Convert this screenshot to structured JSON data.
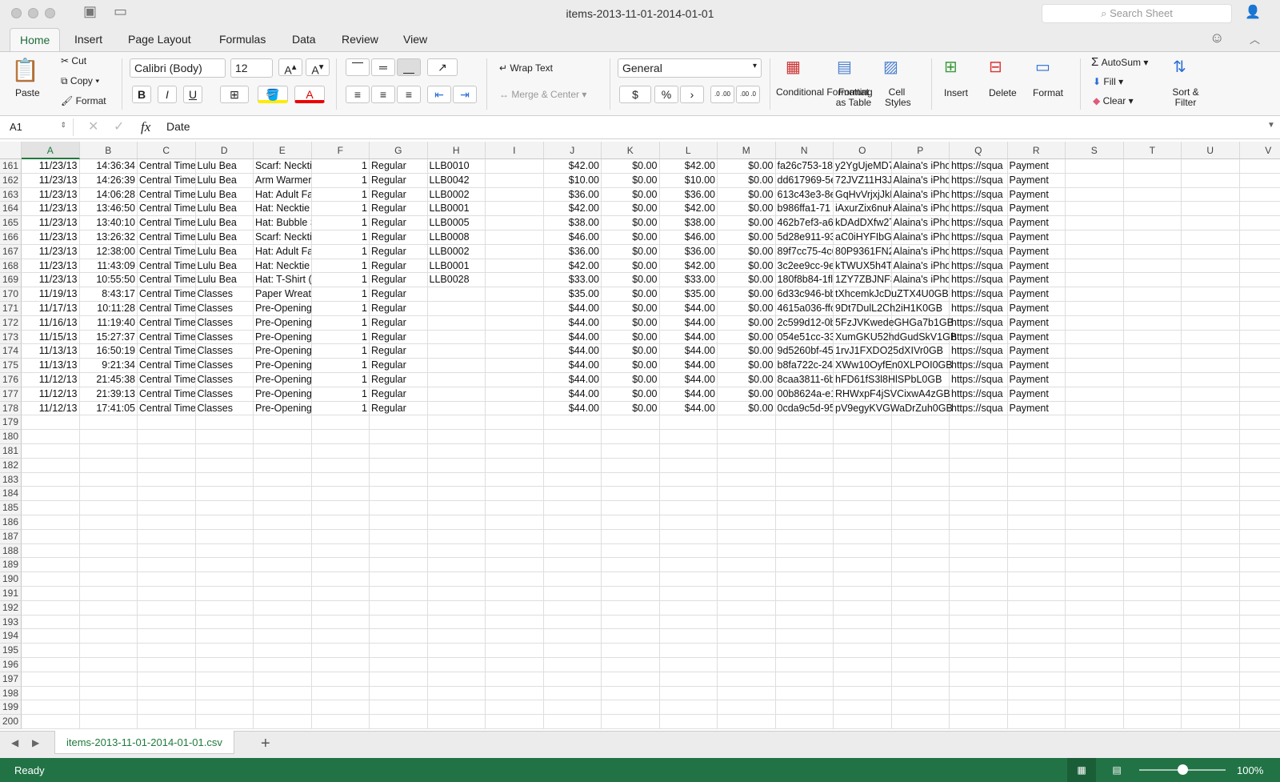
{
  "window": {
    "title": "items-2013-11-01-2014-01-01",
    "search_placeholder": "Search Sheet"
  },
  "tabs": [
    "Home",
    "Insert",
    "Page Layout",
    "Formulas",
    "Data",
    "Review",
    "View"
  ],
  "ribbon": {
    "paste": "Paste",
    "cut": "Cut",
    "copy": "Copy",
    "format_painter": "Format",
    "font": "Calibri (Body)",
    "size": "12",
    "bold": "B",
    "italic": "I",
    "underline": "U",
    "wrap": "Wrap Text",
    "merge": "Merge & Center",
    "number_format": "General",
    "currency": "$",
    "percent": "%",
    "comma": "›",
    "inc_dec": ".0 .00",
    "dec_dec": ".00 .0",
    "cond_fmt": "Conditional Formatting",
    "fmt_table": "Format as Table",
    "cell_styles": "Cell Styles",
    "insert": "Insert",
    "delete": "Delete",
    "format": "Format",
    "autosum": "AutoSum",
    "fill": "Fill",
    "clear": "Clear",
    "sort": "Sort & Filter"
  },
  "formula_bar": {
    "name_box": "A1",
    "fx": "fx",
    "value": "Date"
  },
  "columns": [
    "A",
    "B",
    "C",
    "D",
    "E",
    "F",
    "G",
    "H",
    "I",
    "J",
    "K",
    "L",
    "M",
    "N",
    "O",
    "P",
    "Q",
    "R",
    "S",
    "T",
    "U",
    "V"
  ],
  "rows": [
    {
      "n": "161",
      "c": [
        "11/23/13",
        "14:36:34",
        "Central Time",
        "Lulu Bea",
        "Scarf: Neckti",
        "1",
        "Regular",
        "LLB0010",
        "",
        "$42.00",
        "$0.00",
        "$42.00",
        "$0.00",
        "fa26c753-18",
        "y2YgUjeMD7",
        "Alaina's iPho",
        "https://squa",
        "Payment"
      ]
    },
    {
      "n": "162",
      "c": [
        "11/23/13",
        "14:26:39",
        "Central Time",
        "Lulu Bea",
        "Arm Warmer",
        "1",
        "Regular",
        "LLB0042",
        "",
        "$10.00",
        "$0.00",
        "$10.00",
        "$0.00",
        "dd617969-5e",
        "72JVZ11H3J3",
        "Alaina's iPho",
        "https://squa",
        "Payment"
      ]
    },
    {
      "n": "163",
      "c": [
        "11/23/13",
        "14:06:28",
        "Central Time",
        "Lulu Bea",
        "Hat: Adult Fa",
        "1",
        "Regular",
        "LLB0002",
        "",
        "$36.00",
        "$0.00",
        "$36.00",
        "$0.00",
        "613c43e3-8e",
        "GqHvVrjxjJkN",
        "Alaina's iPho",
        "https://squa",
        "Payment"
      ]
    },
    {
      "n": "164",
      "c": [
        "11/23/13",
        "13:46:50",
        "Central Time",
        "Lulu Bea",
        "Hat: Necktie",
        "1",
        "Regular",
        "LLB0001",
        "",
        "$42.00",
        "$0.00",
        "$42.00",
        "$0.00",
        "b986ffa1-71",
        "iAxurZix6nuK",
        "Alaina's iPho",
        "https://squa",
        "Payment"
      ]
    },
    {
      "n": "165",
      "c": [
        "11/23/13",
        "13:40:10",
        "Central Time",
        "Lulu Bea",
        "Hat: Bubble S",
        "1",
        "Regular",
        "LLB0005",
        "",
        "$38.00",
        "$0.00",
        "$38.00",
        "$0.00",
        "462b7ef3-a6",
        "kDAdDXfw2T",
        "Alaina's iPho",
        "https://squa",
        "Payment"
      ]
    },
    {
      "n": "166",
      "c": [
        "11/23/13",
        "13:26:32",
        "Central Time",
        "Lulu Bea",
        "Scarf: Neckti",
        "1",
        "Regular",
        "LLB0008",
        "",
        "$46.00",
        "$0.00",
        "$46.00",
        "$0.00",
        "5d28e911-93",
        "aC0iHYFIbGV",
        "Alaina's iPho",
        "https://squa",
        "Payment"
      ]
    },
    {
      "n": "167",
      "c": [
        "11/23/13",
        "12:38:00",
        "Central Time",
        "Lulu Bea",
        "Hat: Adult Fa",
        "1",
        "Regular",
        "LLB0002",
        "",
        "$36.00",
        "$0.00",
        "$36.00",
        "$0.00",
        "89f7cc75-4c6",
        "80P9361FN2",
        "Alaina's iPho",
        "https://squa",
        "Payment"
      ]
    },
    {
      "n": "168",
      "c": [
        "11/23/13",
        "11:43:09",
        "Central Time",
        "Lulu Bea",
        "Hat: Necktie",
        "1",
        "Regular",
        "LLB0001",
        "",
        "$42.00",
        "$0.00",
        "$42.00",
        "$0.00",
        "3c2ee9cc-9e",
        "kTWUX5h4TI",
        "Alaina's iPho",
        "https://squa",
        "Payment"
      ]
    },
    {
      "n": "169",
      "c": [
        "11/23/13",
        "10:55:50",
        "Central Time",
        "Lulu Bea",
        "Hat: T-Shirt (",
        "1",
        "Regular",
        "LLB0028",
        "",
        "$33.00",
        "$0.00",
        "$33.00",
        "$0.00",
        "180f8b84-1fl",
        "1ZY7ZBJNF3J",
        "Alaina's iPho",
        "https://squa",
        "Payment"
      ]
    },
    {
      "n": "170",
      "c": [
        "11/19/13",
        "8:43:17",
        "Central Time",
        "Classes",
        "Paper Wreat",
        "1",
        "Regular",
        "",
        "",
        "$35.00",
        "$0.00",
        "$35.00",
        "$0.00",
        "6d33c946-bb",
        "tXhcemkJcDuZTX4U0GB",
        "",
        "https://squa",
        "Payment"
      ]
    },
    {
      "n": "171",
      "c": [
        "11/17/13",
        "10:11:28",
        "Central Time",
        "Classes",
        "Pre-Opening",
        "1",
        "Regular",
        "",
        "",
        "$44.00",
        "$0.00",
        "$44.00",
        "$0.00",
        "4615a036-ffc",
        "9Dt7DulL2Ch2iH1K0GB",
        "",
        "https://squa",
        "Payment"
      ]
    },
    {
      "n": "172",
      "c": [
        "11/16/13",
        "11:19:40",
        "Central Time",
        "Classes",
        "Pre-Opening",
        "1",
        "Regular",
        "",
        "",
        "$44.00",
        "$0.00",
        "$44.00",
        "$0.00",
        "2c599d12-0b",
        "5FzJVKwedeGHGa7b1GB",
        "",
        "https://squa",
        "Payment"
      ]
    },
    {
      "n": "173",
      "c": [
        "11/15/13",
        "15:27:37",
        "Central Time",
        "Classes",
        "Pre-Opening",
        "1",
        "Regular",
        "",
        "",
        "$44.00",
        "$0.00",
        "$44.00",
        "$0.00",
        "054e51cc-33",
        "XumGKU52hdGudSkV1GB",
        "",
        "https://squa",
        "Payment"
      ]
    },
    {
      "n": "174",
      "c": [
        "11/13/13",
        "16:50:19",
        "Central Time",
        "Classes",
        "Pre-Opening",
        "1",
        "Regular",
        "",
        "",
        "$44.00",
        "$0.00",
        "$44.00",
        "$0.00",
        "9d5260bf-45",
        "1rvJ1FXDO25dXIVr0GB",
        "",
        "https://squa",
        "Payment"
      ]
    },
    {
      "n": "175",
      "c": [
        "11/13/13",
        "9:21:34",
        "Central Time",
        "Classes",
        "Pre-Opening",
        "1",
        "Regular",
        "",
        "",
        "$44.00",
        "$0.00",
        "$44.00",
        "$0.00",
        "b8fa722c-24",
        "XWw10OyfEn0XLPOI0GB",
        "",
        "https://squa",
        "Payment"
      ]
    },
    {
      "n": "176",
      "c": [
        "11/12/13",
        "21:45:38",
        "Central Time",
        "Classes",
        "Pre-Opening",
        "1",
        "Regular",
        "",
        "",
        "$44.00",
        "$0.00",
        "$44.00",
        "$0.00",
        "8caa3811-6b",
        "hFD61fS3l8HlSPbL0GB",
        "",
        "https://squa",
        "Payment"
      ]
    },
    {
      "n": "177",
      "c": [
        "11/12/13",
        "21:39:13",
        "Central Time",
        "Classes",
        "Pre-Opening",
        "1",
        "Regular",
        "",
        "",
        "$44.00",
        "$0.00",
        "$44.00",
        "$0.00",
        "00b8624a-e1",
        "RHWxpF4jSVCixwA4zGB",
        "",
        "https://squa",
        "Payment"
      ]
    },
    {
      "n": "178",
      "c": [
        "11/12/13",
        "17:41:05",
        "Central Time",
        "Classes",
        "Pre-Opening",
        "1",
        "Regular",
        "",
        "",
        "$44.00",
        "$0.00",
        "$44.00",
        "$0.00",
        "0cda9c5d-95",
        "pV9egyKVGWaDrZuh0GB",
        "",
        "https://squa",
        "Payment"
      ]
    }
  ],
  "empty_rows": [
    "179",
    "180",
    "181",
    "182",
    "183",
    "184",
    "185",
    "186",
    "187",
    "188",
    "189",
    "190",
    "191",
    "192",
    "193",
    "194",
    "195",
    "196",
    "197",
    "198",
    "199",
    "200"
  ],
  "sheet_tab": "items-2013-11-01-2014-01-01.csv",
  "add_sheet": "+",
  "status": {
    "text": "Ready",
    "zoom": "100%",
    "zoom_level": 100
  }
}
